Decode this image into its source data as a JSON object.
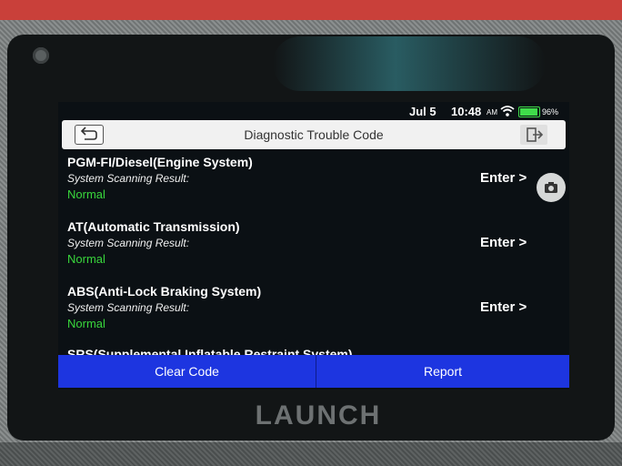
{
  "device": {
    "brand": "LAUNCH"
  },
  "status_bar": {
    "date": "Jul 5",
    "time": "10:48",
    "ampm": "AM",
    "battery": "96%"
  },
  "header": {
    "title": "Diagnostic Trouble Code"
  },
  "systems": [
    {
      "name": "PGM-FI/Diesel(Engine System)",
      "subtitle": "System Scanning Result:",
      "status": "Normal",
      "action": "Enter >"
    },
    {
      "name": "AT(Automatic Transmission)",
      "subtitle": "System Scanning Result:",
      "status": "Normal",
      "action": "Enter >"
    },
    {
      "name": "ABS(Anti-Lock Braking System)",
      "subtitle": "System Scanning Result:",
      "status": "Normal",
      "action": "Enter >"
    }
  ],
  "partial_item": "SRS(Supplemental Inflatable Restraint System)",
  "footer": {
    "clear_code": "Clear Code",
    "report": "Report"
  },
  "colors": {
    "accent": "#1d35e0",
    "normal": "#39d63c"
  },
  "icons": {
    "back": "back-arrow-icon",
    "exit": "exit-icon",
    "camera": "camera-icon",
    "wifi": "wifi-icon",
    "battery": "battery-icon"
  }
}
